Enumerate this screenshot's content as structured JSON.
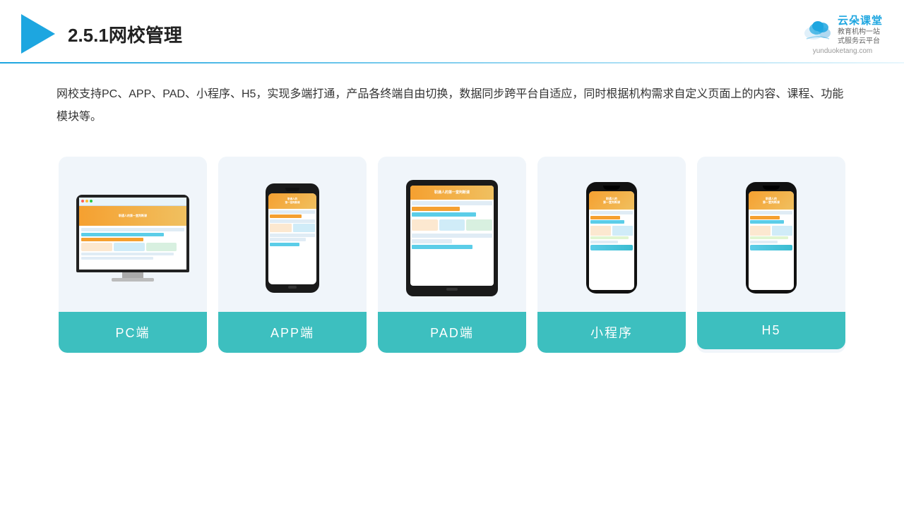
{
  "header": {
    "title": "2.5.1网校管理",
    "brand_name": "云朵课堂",
    "brand_slogan": "教育机构一站\n式服务云平台",
    "brand_url": "yunduoketang.com"
  },
  "description": {
    "text": "网校支持PC、APP、PAD、小程序、H5，实现多端打通，产品各终端自由切换，数据同步跨平台自适应，同时根据机构需求自定义页面上的内容、课程、功能模块等。"
  },
  "cards": [
    {
      "label": "PC端",
      "type": "pc"
    },
    {
      "label": "APP端",
      "type": "phone"
    },
    {
      "label": "PAD端",
      "type": "tablet"
    },
    {
      "label": "小程序",
      "type": "phone_tall"
    },
    {
      "label": "H5",
      "type": "phone_tall2"
    }
  ],
  "colors": {
    "accent": "#1da6e0",
    "card_label": "#3dbfbf",
    "divider_start": "#1da6e0",
    "divider_end": "#e8f7fd"
  }
}
